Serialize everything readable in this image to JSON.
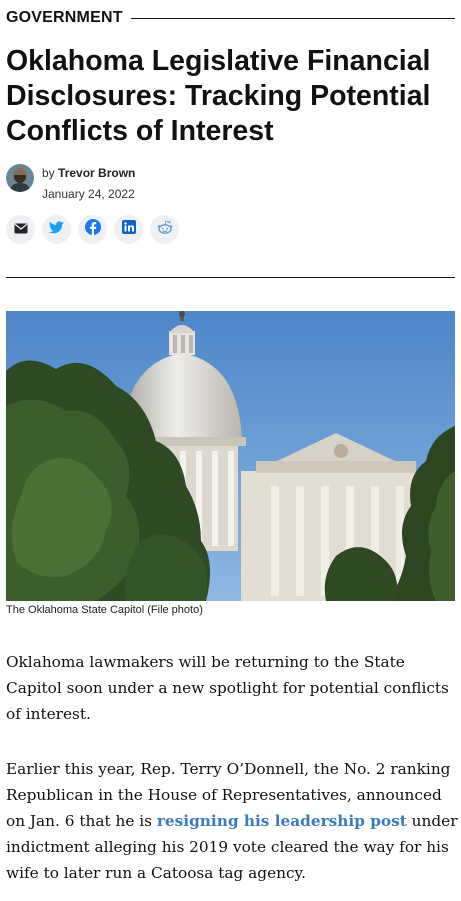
{
  "section": {
    "label": "GOVERNMENT"
  },
  "article": {
    "headline": "Oklahoma Legislative Financial Disclosures: Tracking Potential Conflicts of Interest",
    "byline": {
      "prefix": "by",
      "author": "Trevor Brown",
      "date": "January 24, 2022"
    },
    "share_buttons": [
      {
        "icon": "email-icon",
        "color": "#222222"
      },
      {
        "icon": "twitter-icon",
        "color": "#1da1f2"
      },
      {
        "icon": "facebook-icon",
        "color": "#1877f2"
      },
      {
        "icon": "linkedin-icon",
        "color": "#0a66c2"
      },
      {
        "icon": "reddit-icon",
        "color": "#5f99cf"
      }
    ],
    "photo": {
      "caption": "The Oklahoma State Capitol (File photo)"
    },
    "paragraphs": {
      "p1": "Oklahoma lawmakers will be returning to the State Capitol soon under a new spotlight for potential conflicts of interest.",
      "p2_before": "Earlier this year, Rep. Terry O’Donnell, the No. 2 ranking Republican in the House of Representatives, announced on Jan. 6 that he is ",
      "p2_link": "resigning his leadership post",
      "p2_after": " under indictment alleging his 2019 vote cleared the way for his wife to later run a Catoosa tag agency."
    }
  },
  "colors": {
    "link": "#3b7bbf",
    "text": "#111111",
    "share_bg": "#eef0f3"
  }
}
